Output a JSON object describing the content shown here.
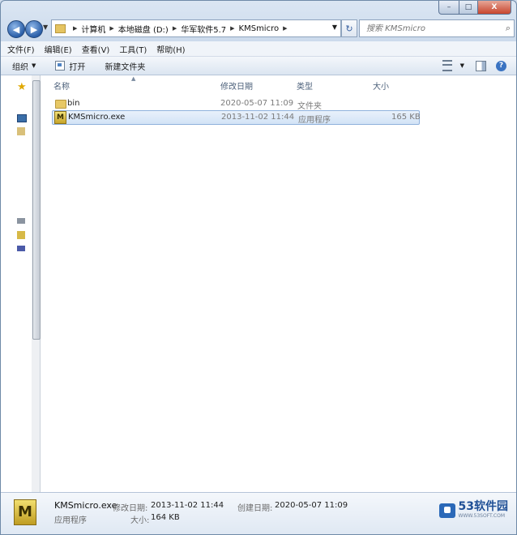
{
  "window": {
    "caption": {
      "minimize": "–",
      "maximize": "□",
      "close": "X"
    }
  },
  "nav": {
    "back": "◀",
    "forward": "▶",
    "breadcrumbs": [
      "计算机",
      "本地磁盘 (D:)",
      "华军软件5.7",
      "KMSmicro"
    ],
    "refresh": "↻",
    "search_placeholder": "搜索 KMSmicro"
  },
  "menu": [
    "文件(F)",
    "编辑(E)",
    "查看(V)",
    "工具(T)",
    "帮助(H)"
  ],
  "toolbar": {
    "organize": "组织",
    "open": "打开",
    "new_folder": "新建文件夹"
  },
  "columns": {
    "name": "名称",
    "modified": "修改日期",
    "type": "类型",
    "size": "大小"
  },
  "files": [
    {
      "name": "bin",
      "modified": "2020-05-07 11:09",
      "type": "文件夹",
      "size": ""
    },
    {
      "name": "KMSmicro.exe",
      "modified": "2013-11-02 11:44",
      "type": "应用程序",
      "size": "165 KB"
    }
  ],
  "details": {
    "name": "KMSmicro.exe",
    "type": "应用程序",
    "modified_label": "修改日期:",
    "modified_value": "2013-11-02 11:44",
    "created_label": "创建日期:",
    "created_value": "2020-05-07 11:09",
    "size_label": "大小:",
    "size_value": "164 KB"
  },
  "watermark": {
    "main": "53软件园",
    "sub": "WWW.53SOFT.COM"
  }
}
